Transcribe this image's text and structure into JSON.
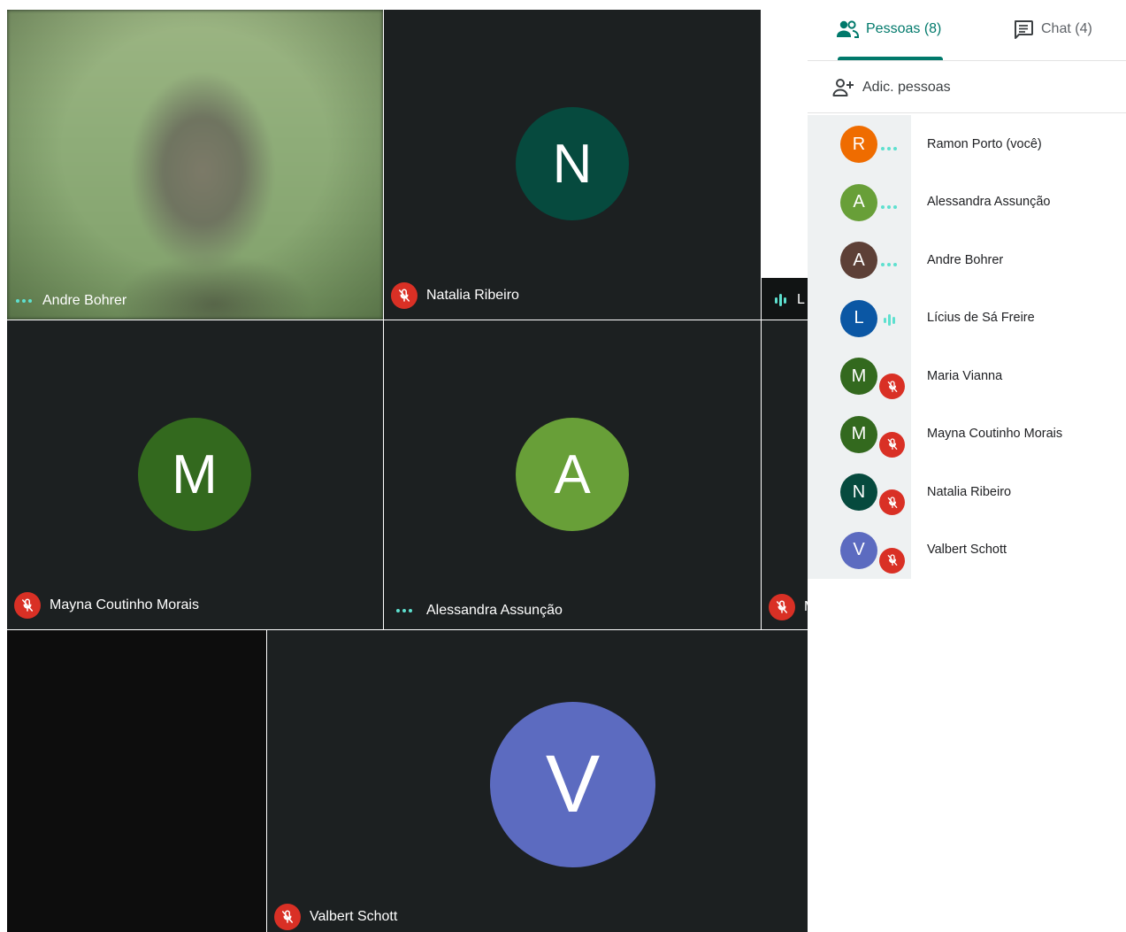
{
  "colors": {
    "accent": "#00796b",
    "mute_red": "#d93025",
    "speaking_teal": "#5ee0cf",
    "tile_bg": "#1c2021"
  },
  "tiles": [
    {
      "name": "Andre Bohrer",
      "status": "dots",
      "camera": true
    },
    {
      "name": "Natalia Ribeiro",
      "status": "muted",
      "initial": "N",
      "color": "#064a3e"
    },
    {
      "name": "L",
      "status": "speaking"
    },
    {
      "name": "Mayna Coutinho Morais",
      "status": "muted",
      "initial": "M",
      "color": "#33691e"
    },
    {
      "name": "Alessandra Assunção",
      "status": "dots",
      "initial": "A",
      "color": "#689f38"
    },
    {
      "name": "M",
      "status": "muted"
    },
    {
      "name": "Valbert Schott",
      "status": "muted",
      "initial": "V",
      "color": "#5c6bc0"
    }
  ],
  "panel": {
    "tabs": [
      {
        "label": "Pessoas (8)",
        "icon": "people-icon",
        "active": true
      },
      {
        "label": "Chat (4)",
        "icon": "chat-icon",
        "active": false
      }
    ],
    "add_people_label": "Adic. pessoas",
    "people": [
      {
        "name": "Ramon Porto (você)",
        "initial": "R",
        "color": "#ef6c00",
        "status": "dots"
      },
      {
        "name": "Alessandra Assunção",
        "initial": "A",
        "color": "#689f38",
        "status": "dots"
      },
      {
        "name": "Andre Bohrer",
        "initial": "A",
        "color": "#5d4037",
        "status": "dots"
      },
      {
        "name": "Lícius de Sá Freire",
        "initial": "L",
        "color": "#0b57a4",
        "status": "speaking"
      },
      {
        "name": "Maria Vianna",
        "initial": "M",
        "color": "#33691e",
        "status": "muted"
      },
      {
        "name": "Mayna Coutinho Morais",
        "initial": "M",
        "color": "#33691e",
        "status": "muted"
      },
      {
        "name": "Natalia Ribeiro",
        "initial": "N",
        "color": "#064a3e",
        "status": "muted"
      },
      {
        "name": "Valbert Schott",
        "initial": "V",
        "color": "#5c6bc0",
        "status": "muted"
      }
    ]
  }
}
